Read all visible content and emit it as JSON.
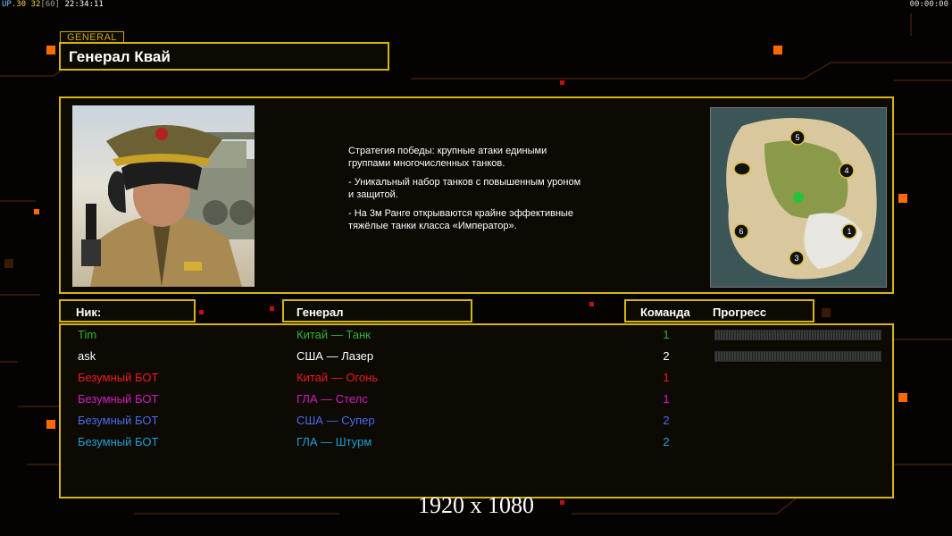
{
  "topbar": {
    "fps_prefix": "UP.",
    "fps_a": "30",
    "fps_b": "32",
    "fps_bracket": "[60]",
    "clock": "22:34:11",
    "timer": "00:00:00"
  },
  "general": {
    "section_label": "GENERAL",
    "name": "Генерал Квай",
    "description": [
      "Стратегия победы: крупные атаки едиными\n группами многочисленных танков.",
      "- Уникальный набор танков с повышенным уроном\n и защитой.",
      "- На 3м Ранге открываются крайне эффективные\n тяжёлые танки класса «Император»."
    ]
  },
  "map": {
    "spawn_numbers": [
      "5",
      "4",
      "6",
      "1",
      "3"
    ]
  },
  "headers": {
    "nick": "Ник:",
    "general": "Генерал",
    "team": "Команда",
    "progress": "Прогресс"
  },
  "players": [
    {
      "nick": "Tim",
      "general": "Китай — Танк",
      "team": "1",
      "color": "#2fb52f",
      "progress": true
    },
    {
      "nick": "ask",
      "general": "США — Лазер",
      "team": "2",
      "color": "#ffffff",
      "progress": true
    },
    {
      "nick": "Безумный БОТ",
      "general": "Китай — Огонь",
      "team": "1",
      "color": "#ee1c1c",
      "progress": false
    },
    {
      "nick": "Безумный БОТ",
      "general": "ГЛА — Стелс",
      "team": "1",
      "color": "#d21dc0",
      "progress": false
    },
    {
      "nick": "Безумный БОТ",
      "general": "США — Супер",
      "team": "2",
      "color": "#4b6cf0",
      "progress": false
    },
    {
      "nick": "Безумный БОТ",
      "general": "ГЛА — Штурм",
      "team": "2",
      "color": "#1fa2d6",
      "progress": false
    }
  ],
  "resolution_label": "1920 x 1080",
  "colors": {
    "frame": "#d7b50d",
    "accent_orange": "#ff7a00"
  }
}
